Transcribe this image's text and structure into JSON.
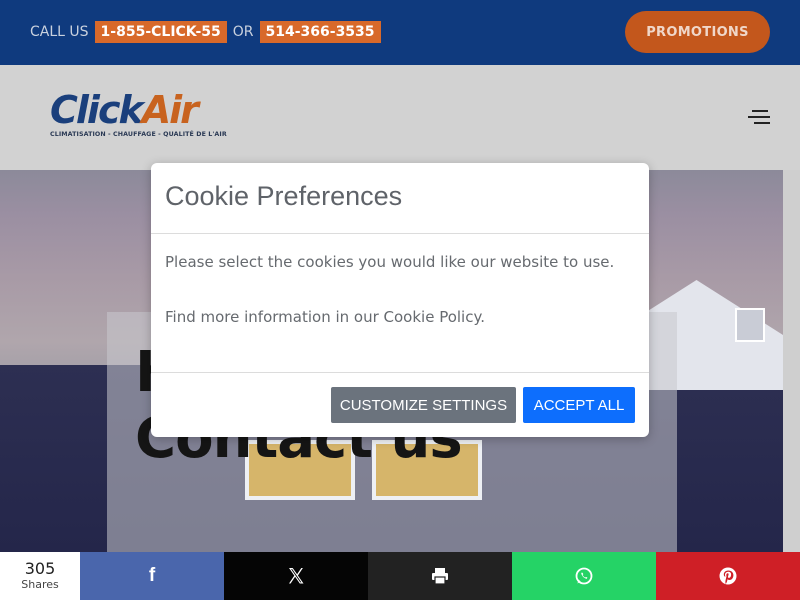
{
  "topbar": {
    "call_label": "CALL US",
    "phone1": "1-855-CLICK-55",
    "or_label": "OR",
    "phone2": "514-366-3535",
    "promotions_label": "PROMOTIONS"
  },
  "header": {
    "logo_word_1": "Click",
    "logo_word_2": "Air",
    "logo_tagline": "CLIMATISATION - CHAUFFAGE - QUALITÉ DE L'AIR",
    "menu_icon": "hamburger-icon"
  },
  "hero": {
    "title": "H Needs? Contact us"
  },
  "cookie_modal": {
    "title": "Cookie Preferences",
    "body_1": "Please select the cookies you would like our website to use.",
    "body_2": "Find more information in our Cookie Policy.",
    "customize_label": "CUSTOMIZE SETTINGS",
    "accept_label": "ACCEPT ALL"
  },
  "share_bar": {
    "count": "305",
    "count_label": "Shares",
    "buttons": [
      {
        "icon": "facebook-icon",
        "color": "#4a66ac"
      },
      {
        "icon": "x-icon",
        "color": "#050505"
      },
      {
        "icon": "print-icon",
        "color": "#222222"
      },
      {
        "icon": "whatsapp-icon",
        "color": "#25d366"
      },
      {
        "icon": "pinterest-icon",
        "color": "#cf1f26"
      }
    ]
  },
  "colors": {
    "topbar_bg": "#0f3a7e",
    "accent_orange": "#d8692a",
    "accept_blue": "#0d6efd",
    "customize_gray": "#6b737d"
  }
}
